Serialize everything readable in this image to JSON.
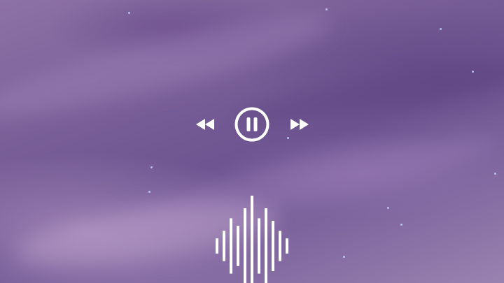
{
  "background": {
    "type": "night-sky-photo",
    "colors": {
      "deep": "#6d5490",
      "mid": "#7a5f98",
      "light": "#9a82b0",
      "star": "#c8d8ff"
    }
  },
  "player": {
    "state": "playing",
    "controls": {
      "rewind_icon": "rewind-icon",
      "pause_icon": "pause-circle-icon",
      "fast_forward_icon": "fast-forward-icon"
    },
    "icon_color": "#ffffff"
  },
  "waveform": {
    "icon": "audio-waveform-icon",
    "color": "#ffffff",
    "bar_levels": [
      0.15,
      0.3,
      0.55,
      0.4,
      0.75,
      1.0,
      0.55,
      0.75,
      0.5,
      0.3,
      0.15
    ]
  }
}
